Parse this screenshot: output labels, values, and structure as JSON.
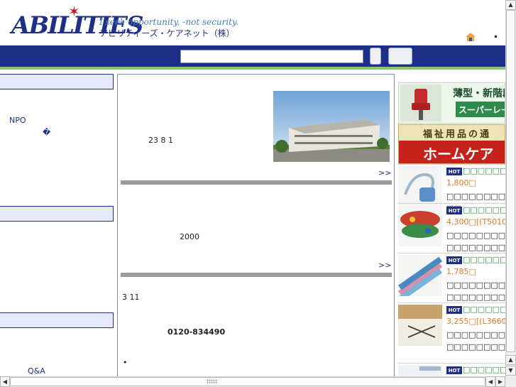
{
  "header": {
    "logo_text": "ABILITIES",
    "tagline_en": "I seek opportunity, -not security.",
    "tagline_jp": "アビリティーズ・ケアネット（株）",
    "home_icon": "home-icon"
  },
  "search": {
    "placeholder": "",
    "value": ""
  },
  "left": {
    "npo_label": "NPO",
    "npo_glyph": "�",
    "qa_label": "Q&A"
  },
  "center": {
    "text_1": "23  8  1",
    "more_1": ">>",
    "text_2": "2000",
    "more_2": ">>",
    "text_3": "3  11",
    "phone": "0120-834490",
    "bullet": "•"
  },
  "right": {
    "banner_1_title": "薄型・新階段",
    "banner_1_sub": "スーパーレーター",
    "banner_2_top": "福祉用品の通",
    "banner_2_bottom": "ホームケア",
    "products": [
      {
        "badge": "HOT",
        "name": "\u0000\u0000\u0000\u0000\u0000\u0000\u0000\u0000\u0000",
        "price": "1,800\u0000",
        "desc": "\u0000\u0000\u0000\u0000\u0000\u0000\u0000\u0000\u0000\u0000"
      },
      {
        "badge": "HOT",
        "name": "\u0000\u0000\u0000\u0000\u0000\u0000\u0000\u0000\u0000",
        "price": "4,300\u0000[(T5010",
        "desc": "\u0000\u0000\u0000\u0000\u0000\u0000\u0000\u0000\u0000\u0000\u0000\u0000\u0000\u0000\u0000\u0000\u0000\u0000\u0000\u0000"
      },
      {
        "badge": "HOT",
        "name": "\u0000\u0000\u0000\u0000\u0000\u0000\u0000\u0000\u0000",
        "price": "1,785\u0000",
        "desc": "\u0000\u0000\u0000\u0000\u0000\u0000\u0000\u0000\u0000\u0000\u0000\u0000\u0000\u0000\u0000\u0000"
      },
      {
        "badge": "HOT",
        "name": "\u0000\u0000\u0000\u0000\u0000\u0000\u0000\u0000\u0000",
        "price": "3,255\u0000[(L3660",
        "desc": "\u0000\u0000\u0000\u0000\u0000\u0000\u0000\u0000\u0000\u0000\u0000\u0000\u0000\u0000\u0000\u0000\u0000\u0000\u0000\u0000\u0000"
      },
      {
        "badge": "HOT",
        "name": "\u0000\u0000\u0000\u0000\u0000\u0000\u0000\u0000\u0000",
        "price": "",
        "desc": ""
      }
    ]
  },
  "scrollbars": {
    "up_glyph": "▲",
    "down_glyph": "▼",
    "left_glyph": "◀",
    "right_glyph": "▶"
  },
  "colors": {
    "navbar": "#1d2f85",
    "accent_green": "#8cc36e",
    "product_name": "#2b8a3a",
    "product_price": "#e07a20"
  }
}
